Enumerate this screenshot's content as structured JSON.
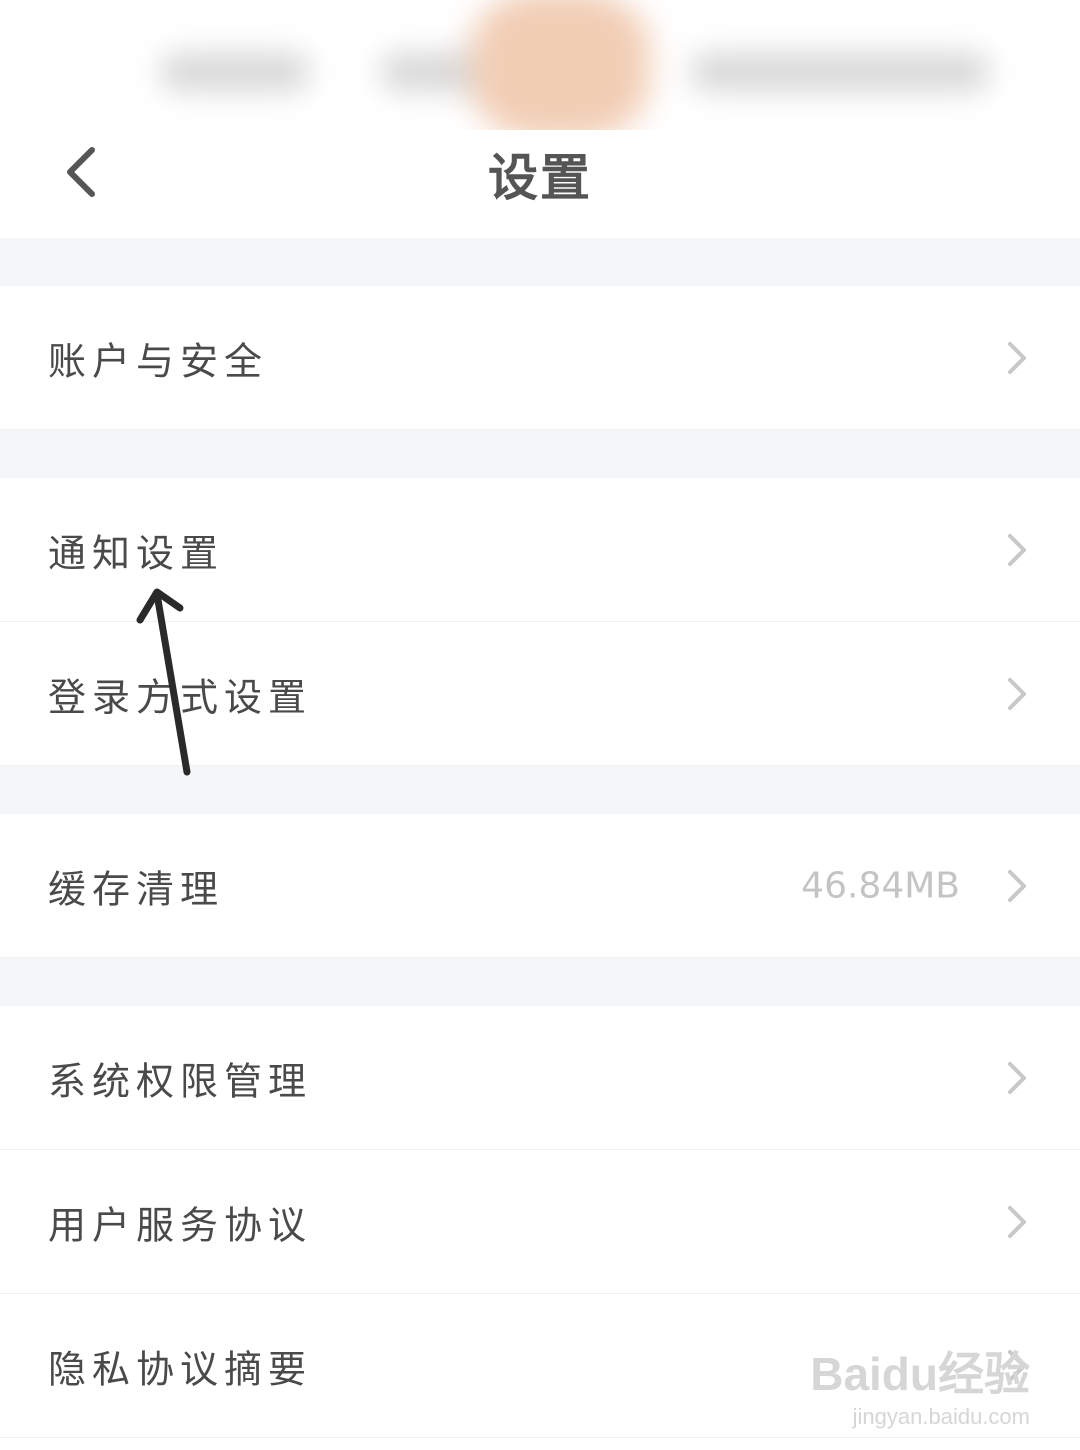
{
  "header": {
    "title": "设置",
    "back_icon": "chevron-left-icon"
  },
  "sections": [
    {
      "rows": [
        {
          "label": "账户与安全",
          "value": ""
        }
      ]
    },
    {
      "rows": [
        {
          "label": "通知设置",
          "value": ""
        },
        {
          "label": "登录方式设置",
          "value": ""
        }
      ]
    },
    {
      "rows": [
        {
          "label": "缓存清理",
          "value": "46.84MB"
        }
      ]
    },
    {
      "rows": [
        {
          "label": "系统权限管理",
          "value": ""
        },
        {
          "label": "用户服务协议",
          "value": ""
        },
        {
          "label": "隐私协议摘要",
          "value": ""
        }
      ]
    }
  ],
  "watermark": {
    "logo": "Baidu经验",
    "url": "jingyan.baidu.com"
  },
  "colors": {
    "background": "#ffffff",
    "section_gap": "#f5f6f9",
    "label_text": "#4a4a4a",
    "value_text": "#c4c4c4",
    "chevron": "#c8c8c8"
  }
}
